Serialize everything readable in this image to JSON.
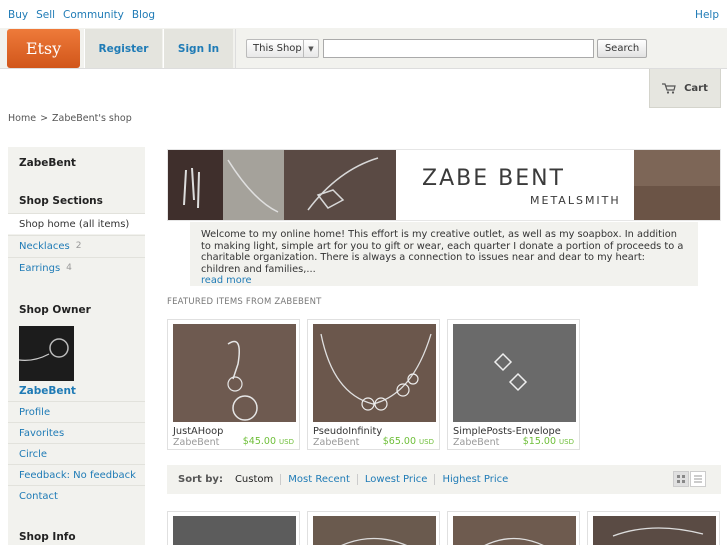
{
  "topnav": {
    "links": [
      "Buy",
      "Sell",
      "Community",
      "Blog"
    ],
    "help": "Help"
  },
  "header": {
    "logo": "Etsy",
    "register": "Register",
    "signin": "Sign In",
    "search_scope": "This Shop",
    "search_value": "",
    "search_button": "Search",
    "cart": "Cart"
  },
  "breadcrumb": [
    "Home",
    ">",
    "ZabeBent's shop"
  ],
  "sidebar": {
    "shop_name": "ZabeBent",
    "sections_title": "Shop Sections",
    "sections": [
      {
        "label": "Shop home (all items)",
        "count": ""
      },
      {
        "label": "Necklaces",
        "count": "2"
      },
      {
        "label": "Earrings",
        "count": "4"
      }
    ],
    "owner_title": "Shop Owner",
    "owner_name": "ZabeBent",
    "owner_links": [
      "Profile",
      "Favorites",
      "Circle",
      "Feedback: No feedback",
      "Contact"
    ],
    "info_title": "Shop Info"
  },
  "banner": {
    "title": "ZABE BENT",
    "subtitle": "METALSMITH"
  },
  "announcement": {
    "text": "Welcome to my online home! This effort is my creative outlet, as well as my soapbox. In addition to making light, simple art for you to gift or wear, each quarter I donate a portion of proceeds to a charitable organization. There is always a connection to issues near and dear to my heart: children and families,...",
    "more": "read more"
  },
  "featured": {
    "heading": "FEATURED ITEMS FROM ZABEBENT",
    "items": [
      {
        "title": "JustAHoop",
        "seller": "ZabeBent",
        "price": "$45.00",
        "currency": "USD"
      },
      {
        "title": "PseudoInfinity",
        "seller": "ZabeBent",
        "price": "$65.00",
        "currency": "USD"
      },
      {
        "title": "SimplePosts-Envelope",
        "seller": "ZabeBent",
        "price": "$15.00",
        "currency": "USD"
      }
    ]
  },
  "sort": {
    "label": "Sort by:",
    "options": [
      "Custom",
      "Most Recent",
      "Lowest Price",
      "Highest Price"
    ]
  },
  "colors": {
    "link": "#1f7bb6",
    "etsy_orange": "#d5641c",
    "price_green": "#6fbf3a",
    "panel_bg": "#f2f2ee"
  }
}
